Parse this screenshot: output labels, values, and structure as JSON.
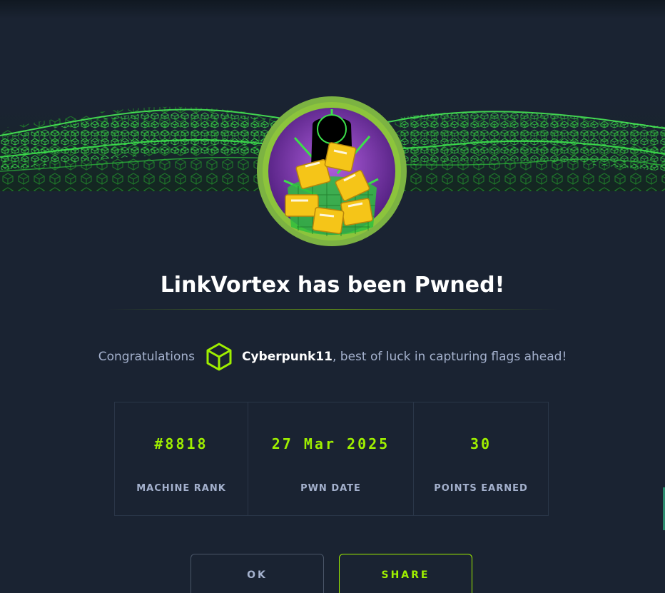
{
  "title": "LinkVortex has been Pwned!",
  "congrats": {
    "prefix": "Congratulations",
    "username": "Cyberpunk11",
    "suffix": ", best of luck in capturing flags ahead!"
  },
  "stats": [
    {
      "value": "#8818",
      "label": "MACHINE RANK"
    },
    {
      "value": "27 Mar 2025",
      "label": "PWN DATE"
    },
    {
      "value": "30",
      "label": "POINTS EARNED"
    }
  ],
  "buttons": {
    "ok": "OK",
    "share": "SHARE"
  },
  "colors": {
    "background": "#1a2332",
    "accent": "#9fef00",
    "muted_text": "#a4b1cd",
    "avatar_ring": "#8cc43c",
    "avatar_inner": "#6a2b9a"
  },
  "icons": {
    "banner": "green-wireframe-wave-banner",
    "avatar": "machine-avatar-chained-folders",
    "user": "green-cube-icon"
  }
}
